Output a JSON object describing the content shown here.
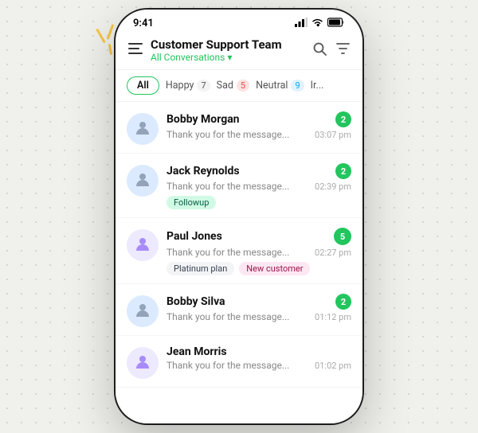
{
  "decorative": {
    "lines_label": "decorative lines"
  },
  "status_bar": {
    "time": "9:41",
    "signal": "▲▲▲",
    "wifi": "wifi",
    "battery": "battery"
  },
  "header": {
    "title": "Customer Support Team",
    "subtitle": "All Conversations",
    "subtitle_chevron": "▾",
    "search_icon": "search",
    "filter_icon": "filter"
  },
  "tabs": [
    {
      "label": "All",
      "active": true,
      "badge": null,
      "badge_type": ""
    },
    {
      "label": "Happy",
      "active": false,
      "badge": "7",
      "badge_type": ""
    },
    {
      "label": "Sad",
      "active": false,
      "badge": "5",
      "badge_type": "sad"
    },
    {
      "label": "Neutral",
      "active": false,
      "badge": "9",
      "badge_type": "neutral"
    },
    {
      "label": "Ir...",
      "active": false,
      "badge": null,
      "badge_type": ""
    }
  ],
  "conversations": [
    {
      "name": "Bobby Morgan",
      "preview": "Thank you for the message...",
      "time": "03:07 pm",
      "badge": "2",
      "avatar_type": "blue",
      "tags": []
    },
    {
      "name": "Jack Reynolds",
      "preview": "Thank you for the message...",
      "time": "02:39 pm",
      "badge": "2",
      "avatar_type": "blue",
      "tags": [
        {
          "label": "Followup",
          "type": "followup"
        }
      ]
    },
    {
      "name": "Paul Jones",
      "preview": "Thank you for the message...",
      "time": "02:27 pm",
      "badge": "5",
      "avatar_type": "purple",
      "tags": [
        {
          "label": "Platinum plan",
          "type": "platinum"
        },
        {
          "label": "New customer",
          "type": "new-customer"
        }
      ]
    },
    {
      "name": "Bobby Silva",
      "preview": "Thank you for the message...",
      "time": "01:12 pm",
      "badge": "2",
      "avatar_type": "blue",
      "tags": []
    },
    {
      "name": "Jean Morris",
      "preview": "Thank you for the message...",
      "time": "01:02 pm",
      "badge": null,
      "avatar_type": "purple",
      "tags": []
    }
  ]
}
